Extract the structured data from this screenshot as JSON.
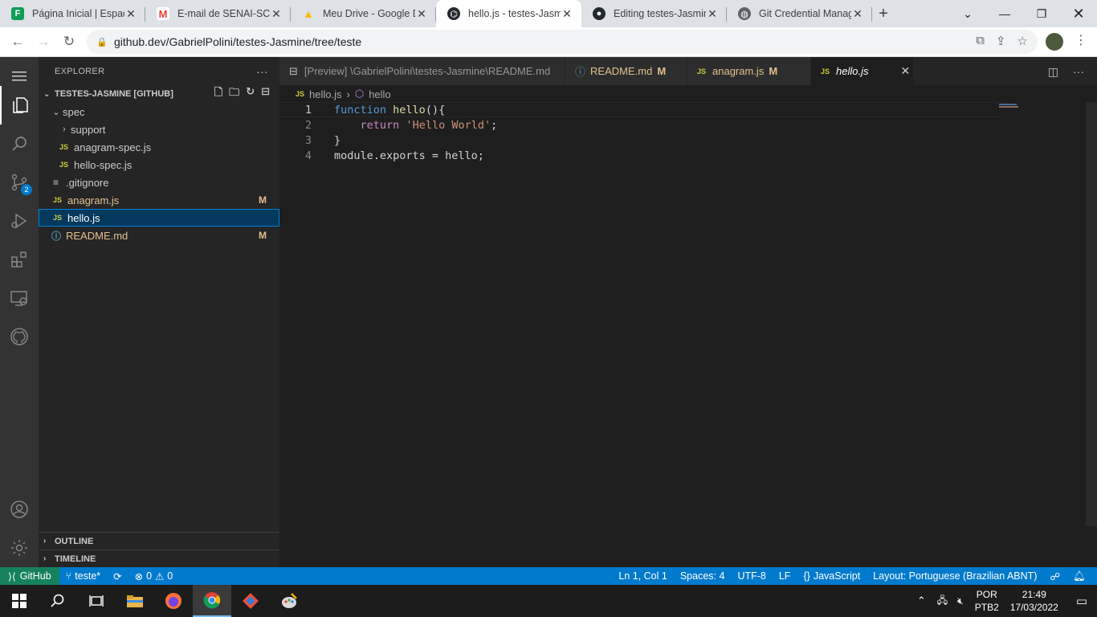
{
  "browser": {
    "tabs": [
      {
        "title": "Página Inicial | Espaço",
        "favicon": "forms-icon",
        "color": "#0f9d58",
        "glyph": "F"
      },
      {
        "title": "E-mail de SENAI-SC Se",
        "favicon": "gmail-icon",
        "color": "#ea4335",
        "glyph": "M"
      },
      {
        "title": "Meu Drive - Google D",
        "favicon": "drive-icon",
        "color": "#fbbc04",
        "glyph": "▲"
      },
      {
        "title": "hello.js - testes-Jasmir",
        "favicon": "github-dev-icon",
        "color": "#24292f",
        "glyph": "⌬"
      },
      {
        "title": "Editing testes-Jasmine",
        "favicon": "github-icon",
        "color": "#24292f",
        "glyph": "●"
      },
      {
        "title": "Git Credential Manag",
        "favicon": "globe-icon",
        "color": "#5f6368",
        "glyph": "◍"
      }
    ],
    "active_tab": 3,
    "url": "github.dev/GabrielPolini/testes-Jasmine/tree/teste"
  },
  "explorer": {
    "title": "EXPLORER",
    "workspace": "TESTES-JASMINE [GITHUB]",
    "tree": [
      {
        "label": "spec",
        "type": "folder-open",
        "indent": 1
      },
      {
        "label": "support",
        "type": "folder",
        "indent": 2
      },
      {
        "label": "anagram-spec.js",
        "type": "js",
        "indent": 2
      },
      {
        "label": "hello-spec.js",
        "type": "js",
        "indent": 2
      },
      {
        "label": ".gitignore",
        "type": "text",
        "indent": 1
      },
      {
        "label": "anagram.js",
        "type": "js",
        "indent": 1,
        "status": "M"
      },
      {
        "label": "hello.js",
        "type": "js",
        "indent": 1,
        "selected": true
      },
      {
        "label": "README.md",
        "type": "info",
        "indent": 1,
        "status": "M"
      }
    ],
    "outline": "OUTLINE",
    "timeline": "TIMELINE"
  },
  "editor": {
    "tabs": [
      {
        "label": "[Preview] \\GabrielPolini\\testes-Jasmine\\README.md",
        "icon": "preview-icon"
      },
      {
        "label": "README.md",
        "icon": "info-icon",
        "status": "M"
      },
      {
        "label": "anagram.js",
        "icon": "js-icon",
        "status": "M"
      },
      {
        "label": "hello.js",
        "icon": "js-icon",
        "active": true
      }
    ],
    "breadcrumb": {
      "file": "hello.js",
      "symbol": "hello"
    },
    "lines": [
      "1",
      "2",
      "3",
      "4"
    ],
    "code": {
      "l1_kw": "function",
      "l1_fn": "hello",
      "l1_rest": "(){",
      "l2_kw": "return",
      "l2_str": "'Hello World'",
      "l2_rest": ";",
      "l3": "}",
      "l4": "module.exports = hello;"
    }
  },
  "status": {
    "remote": "GitHub",
    "branch": "teste*",
    "errors": "0",
    "warnings": "0",
    "position": "Ln 1, Col 1",
    "spaces": "Spaces: 4",
    "encoding": "UTF-8",
    "eol": "LF",
    "language": "JavaScript",
    "layout": "Layout: Portuguese (Brazilian ABNT)"
  },
  "taskbar": {
    "lang_top": "POR",
    "lang_bottom": "PTB2",
    "time": "21:49",
    "date": "17/03/2022"
  },
  "badges": {
    "scm_count": "2"
  }
}
